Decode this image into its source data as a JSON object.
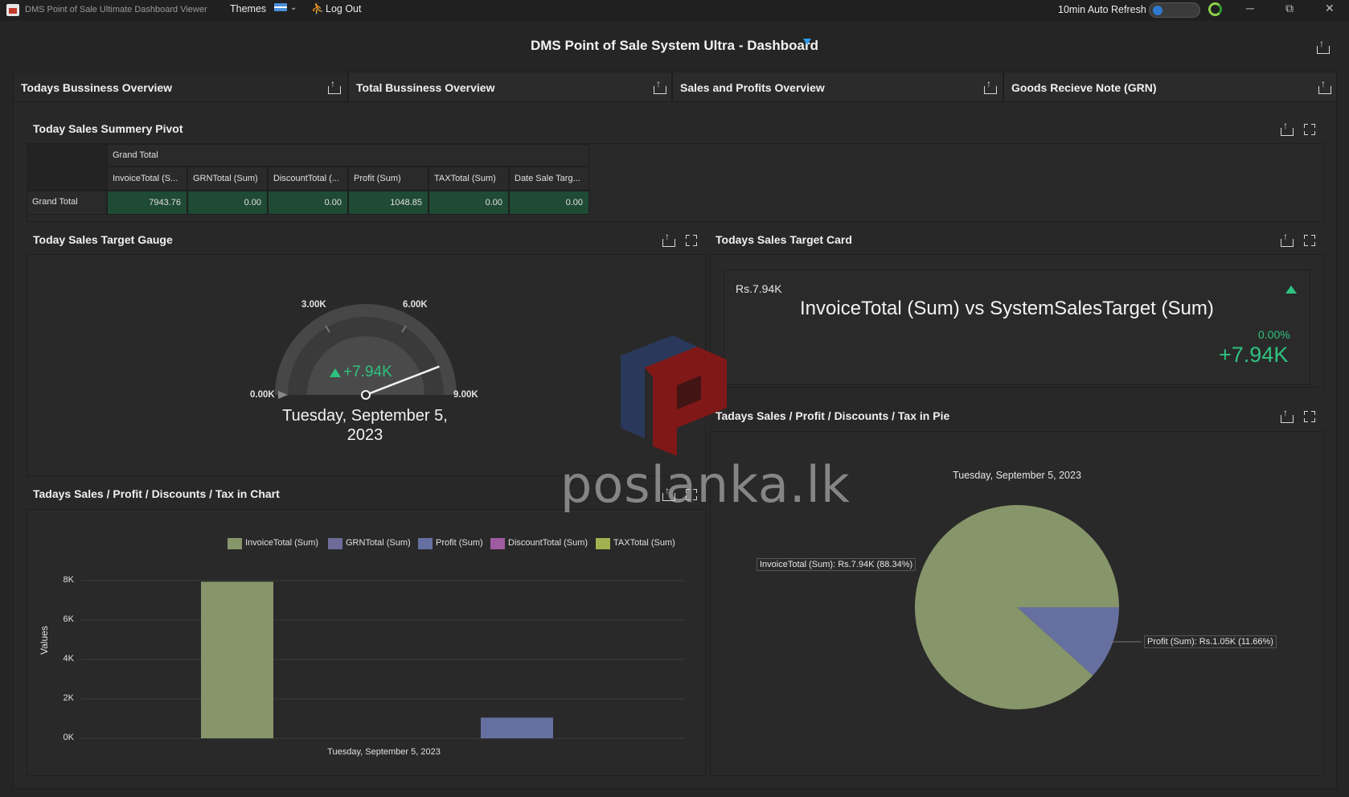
{
  "window": {
    "app_title": "DMS Point of Sale Ultimate Dashboard Viewer",
    "menu_themes": "Themes",
    "menu_logout": "Log Out",
    "auto_refresh_label": "10min Auto Refresh",
    "win_min": "─",
    "win_restore": "⧉",
    "win_close": "✕"
  },
  "dashboard": {
    "title": "DMS Point of Sale System Ultra - Dashboard"
  },
  "tabs": [
    {
      "label": "Todays Bussiness Overview",
      "active": true
    },
    {
      "label": "Total Bussiness Overview"
    },
    {
      "label": "Sales and Profits Overview"
    },
    {
      "label": "Goods Recieve Note (GRN)"
    }
  ],
  "pivot": {
    "title": "Today Sales Summery Pivot",
    "group_header": "Grand Total",
    "row_header": "Grand Total",
    "columns": [
      "InvoiceTotal (S...",
      "GRNTotal (Sum)",
      "DiscountTotal (...",
      "Profit (Sum)",
      "TAXTotal (Sum)",
      "Date Sale Targ..."
    ],
    "values": [
      "7943.76",
      "0.00",
      "0.00",
      "1048.85",
      "0.00",
      "0.00"
    ]
  },
  "gauge": {
    "title": "Today Sales Target Gauge",
    "ticks": [
      "0.00K",
      "3.00K",
      "6.00K",
      "9.00K"
    ],
    "value_text": "+7.94K",
    "value": 7943.76,
    "range": [
      0,
      9000
    ],
    "date_line1": "Tuesday, September 5,",
    "date_line2": "2023"
  },
  "card": {
    "title": "Todays Sales Target Card",
    "currency_value": "Rs.7.94K",
    "main_text": "InvoiceTotal (Sum) vs SystemSalesTarget (Sum)",
    "percent": "0.00%",
    "delta": "+7.94K"
  },
  "bar_chart": {
    "title": "Tadays Sales / Profit / Discounts / Tax in Chart",
    "ylabel": "Values",
    "xlabel": "Tuesday, September 5, 2023",
    "yticks": [
      "0K",
      "2K",
      "4K",
      "6K",
      "8K"
    ]
  },
  "pie_chart": {
    "title": "Tadays Sales / Profit / Discounts / Tax in Pie",
    "date_title": "Tuesday, September 5, 2023",
    "label_invoice": "InvoiceTotal (Sum): Rs.7.94K (88.34%)",
    "label_profit": "Profit (Sum): Rs.1.05K (11.66%)"
  },
  "chart_data": [
    {
      "type": "bar",
      "categories": [
        "Tuesday, September 5, 2023"
      ],
      "series": [
        {
          "name": "InvoiceTotal (Sum)",
          "values": [
            7943.76
          ],
          "color": "#87966a"
        },
        {
          "name": "GRNTotal (Sum)",
          "values": [
            0
          ],
          "color": "#6e6a99"
        },
        {
          "name": "Profit (Sum)",
          "values": [
            1048.85
          ],
          "color": "#6670a0"
        },
        {
          "name": "DiscountTotal (Sum)",
          "values": [
            0
          ],
          "color": "#a05ca0"
        },
        {
          "name": "TAXTotal (Sum)",
          "values": [
            0
          ],
          "color": "#a3b04f"
        }
      ],
      "ylabel": "Values",
      "ylim": [
        0,
        8000
      ],
      "grid": true,
      "legend": "top"
    },
    {
      "type": "pie",
      "title": "Tuesday, September 5, 2023",
      "slices": [
        {
          "name": "InvoiceTotal (Sum)",
          "value": 7943.76,
          "percent": 88.34,
          "color": "#87966a"
        },
        {
          "name": "Profit (Sum)",
          "value": 1048.85,
          "percent": 11.66,
          "color": "#6670a0"
        }
      ]
    }
  ],
  "watermark": {
    "text": "poslanka.lk"
  },
  "colors": {
    "positive": "#2ec27e",
    "accent": "#2f7ad0"
  }
}
